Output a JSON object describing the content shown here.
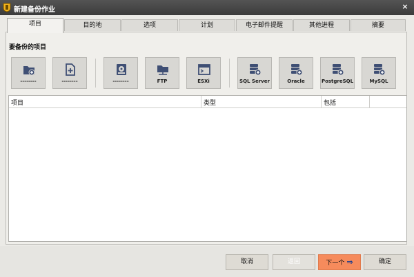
{
  "window": {
    "title": "新建备份作业",
    "close_glyph": "×"
  },
  "tabs": [
    {
      "label": "项目",
      "active": true
    },
    {
      "label": "目的地",
      "active": false
    },
    {
      "label": "选项",
      "active": false
    },
    {
      "label": "计划",
      "active": false
    },
    {
      "label": "电子邮件提醒",
      "active": false
    },
    {
      "label": "其他进程",
      "active": false
    },
    {
      "label": "摘要",
      "active": false
    }
  ],
  "section_label": "要备份的项目",
  "sources": [
    {
      "label": "--------",
      "icon": "folder-add-icon"
    },
    {
      "label": "--------",
      "icon": "file-add-icon"
    },
    {
      "label": "--------",
      "icon": "disk-icon"
    },
    {
      "label": "FTP",
      "icon": "ftp-folder-icon"
    },
    {
      "label": "ESXi",
      "icon": "esxi-window-icon"
    },
    {
      "label": "SQL Server",
      "icon": "database-add-icon"
    },
    {
      "label": "Oracle",
      "icon": "database-add-icon"
    },
    {
      "label": "PostgreSQL",
      "icon": "database-add-icon"
    },
    {
      "label": "MySQL",
      "icon": "database-add-icon"
    }
  ],
  "table": {
    "columns": [
      "项目",
      "类型",
      "包括"
    ],
    "rows": []
  },
  "footer": {
    "cancel": "取消",
    "back": "返回",
    "next": "下一个",
    "next_arrow": "⇒",
    "ok": "确定"
  },
  "colors": {
    "accent": "#f68b5c",
    "icon": "#3f4f74",
    "titlebar": "#4a4a4a"
  }
}
